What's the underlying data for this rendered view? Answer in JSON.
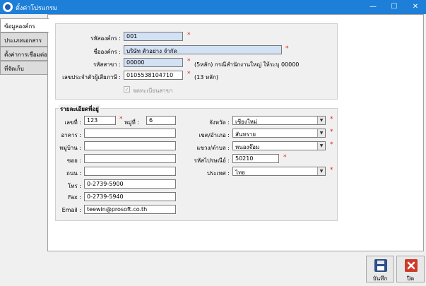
{
  "window": {
    "title": "ตั้งค่าโปรแกรม",
    "minimize": "—",
    "maximize": "☐",
    "close": "✕"
  },
  "tabs": [
    {
      "label": "ข้อมูลองค์กร",
      "active": true
    },
    {
      "label": "ประเภทเอกสาร",
      "active": false
    },
    {
      "label": "ตั้งค่าการเชื่อมต่อ",
      "active": false
    },
    {
      "label": "ที่จัดเก็บ",
      "active": false
    }
  ],
  "org": {
    "code_label": "รหัสองค์กร :",
    "code_value": "001",
    "name_label": "ชื่อองค์กร :",
    "name_value": "บริษัท ตัวอย่าง จำกัด",
    "branch_label": "รหัสสาขา :",
    "branch_value": "00000",
    "branch_hint": "(5หลัก) กรณีสำนักงานใหญ่ ให้ระบุ 00000",
    "tax_label": "เลขประจำตัวผู้เสียภาษี :",
    "tax_value": "0105538104710",
    "tax_hint": "(13 หลัก)",
    "register_branch_label": "จดทะเบียนสาขา",
    "required_mark": "*"
  },
  "address": {
    "group_title": "รายละเอียดที่อยู่",
    "house_no_label": "เลขที่ :",
    "house_no_value": "123",
    "moo_label": "หมู่ที่ :",
    "moo_value": "6",
    "building_label": "อาคาร :",
    "building_value": "",
    "village_label": "หมู่บ้าน :",
    "village_value": "",
    "soi_label": "ซอย :",
    "soi_value": "",
    "road_label": "ถนน :",
    "road_value": "",
    "phone_label": "โทร :",
    "phone_value": "0-2739-5900",
    "fax_label": "Fax :",
    "fax_value": "0-2739-5940",
    "email_label": "Email :",
    "email_value": "teewin@prosoft.co.th",
    "province_label": "จังหวัด :",
    "province_value": "เชียงใหม่",
    "district_label": "เขต/อำเภอ :",
    "district_value": "สันทราย",
    "subdistrict_label": "แขวง/ตำบล :",
    "subdistrict_value": "หนองจ๊อม",
    "postcode_label": "รหัสไปรษณีย์ :",
    "postcode_value": "50210",
    "country_label": "ประเทศ :",
    "country_value": "ไทย",
    "dropdown_arrow": "▼"
  },
  "buttons": {
    "save_label": "บันทึก",
    "close_label": "ปิด"
  },
  "colors": {
    "titlebar": "#1e7fd9",
    "readonly_field": "#d3e1f5",
    "required": "#e02020"
  }
}
